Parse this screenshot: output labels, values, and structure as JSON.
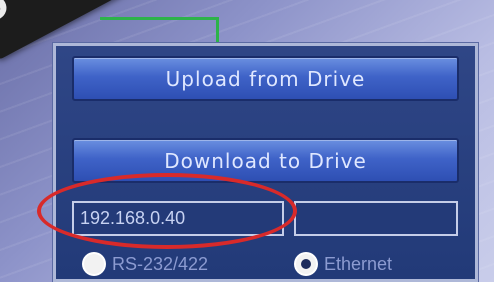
{
  "buttons": {
    "upload_label": "Upload from Drive",
    "download_label": "Download to Drive"
  },
  "connection": {
    "ip_value": "192.168.0.40",
    "port_value": "",
    "options": [
      {
        "label": "RS-232/422",
        "selected": false
      },
      {
        "label": "Ethernet",
        "selected": true
      }
    ]
  },
  "icons": {
    "cable": "connector-icon",
    "radio": "radio-button-icon"
  },
  "colors": {
    "annotation": "#d82a2a",
    "wire": "#2db34a",
    "panel": "#2f4686"
  }
}
